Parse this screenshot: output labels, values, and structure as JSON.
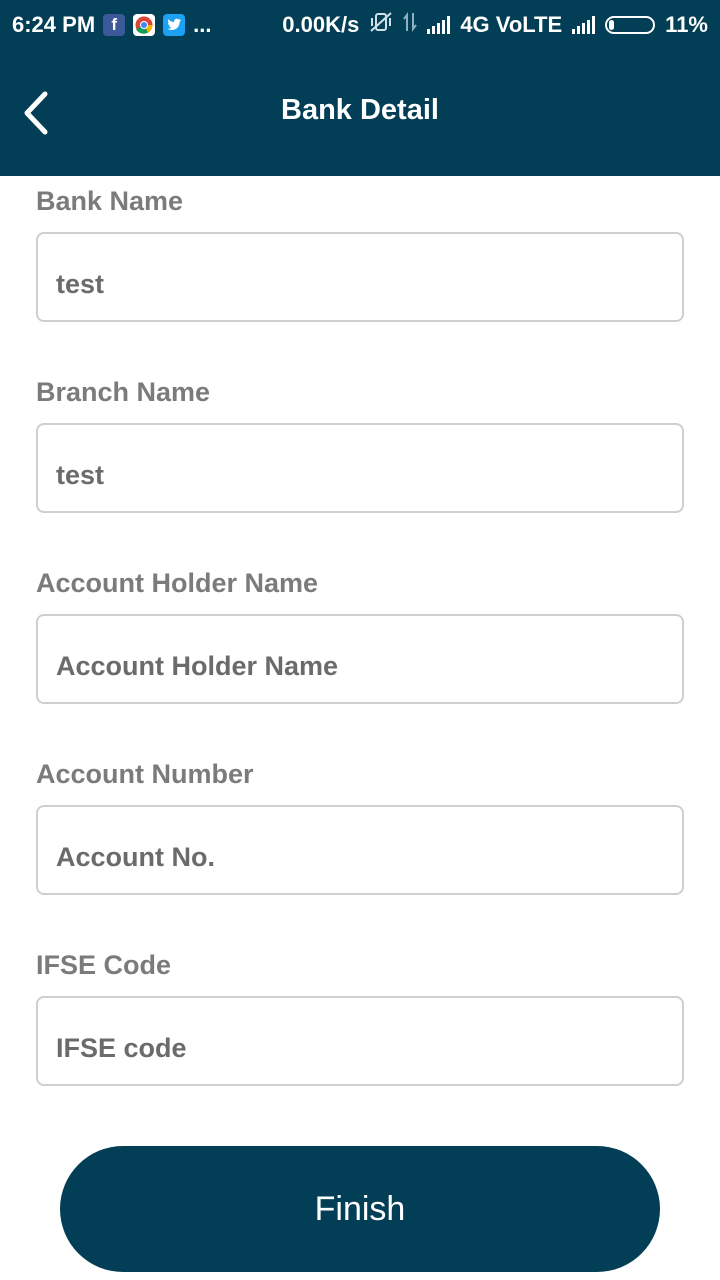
{
  "status_bar": {
    "time": "6:24 PM",
    "net_speed": "0.00K/s",
    "network": "4G VoLTE",
    "battery": "11%",
    "battery_level": 0.11,
    "dots": "...",
    "app_icons": [
      "facebook-icon",
      "chrome-icon",
      "twitter-icon"
    ]
  },
  "header": {
    "title": "Bank Detail",
    "back_icon": "chevron-left-icon"
  },
  "form": {
    "fields": [
      {
        "label": "Bank Name",
        "value": "test",
        "placeholder": ""
      },
      {
        "label": "Branch Name",
        "value": "test",
        "placeholder": ""
      },
      {
        "label": "Account Holder Name",
        "value": "",
        "placeholder": "Account Holder Name"
      },
      {
        "label": "Account Number",
        "value": "",
        "placeholder": "Account No."
      },
      {
        "label": "IFSE Code",
        "value": "",
        "placeholder": "IFSE code"
      }
    ]
  },
  "finish_button": {
    "label": "Finish"
  },
  "colors": {
    "primary": "#023e55",
    "label_text": "#7b7b7b",
    "input_border": "#cfcfcf"
  }
}
